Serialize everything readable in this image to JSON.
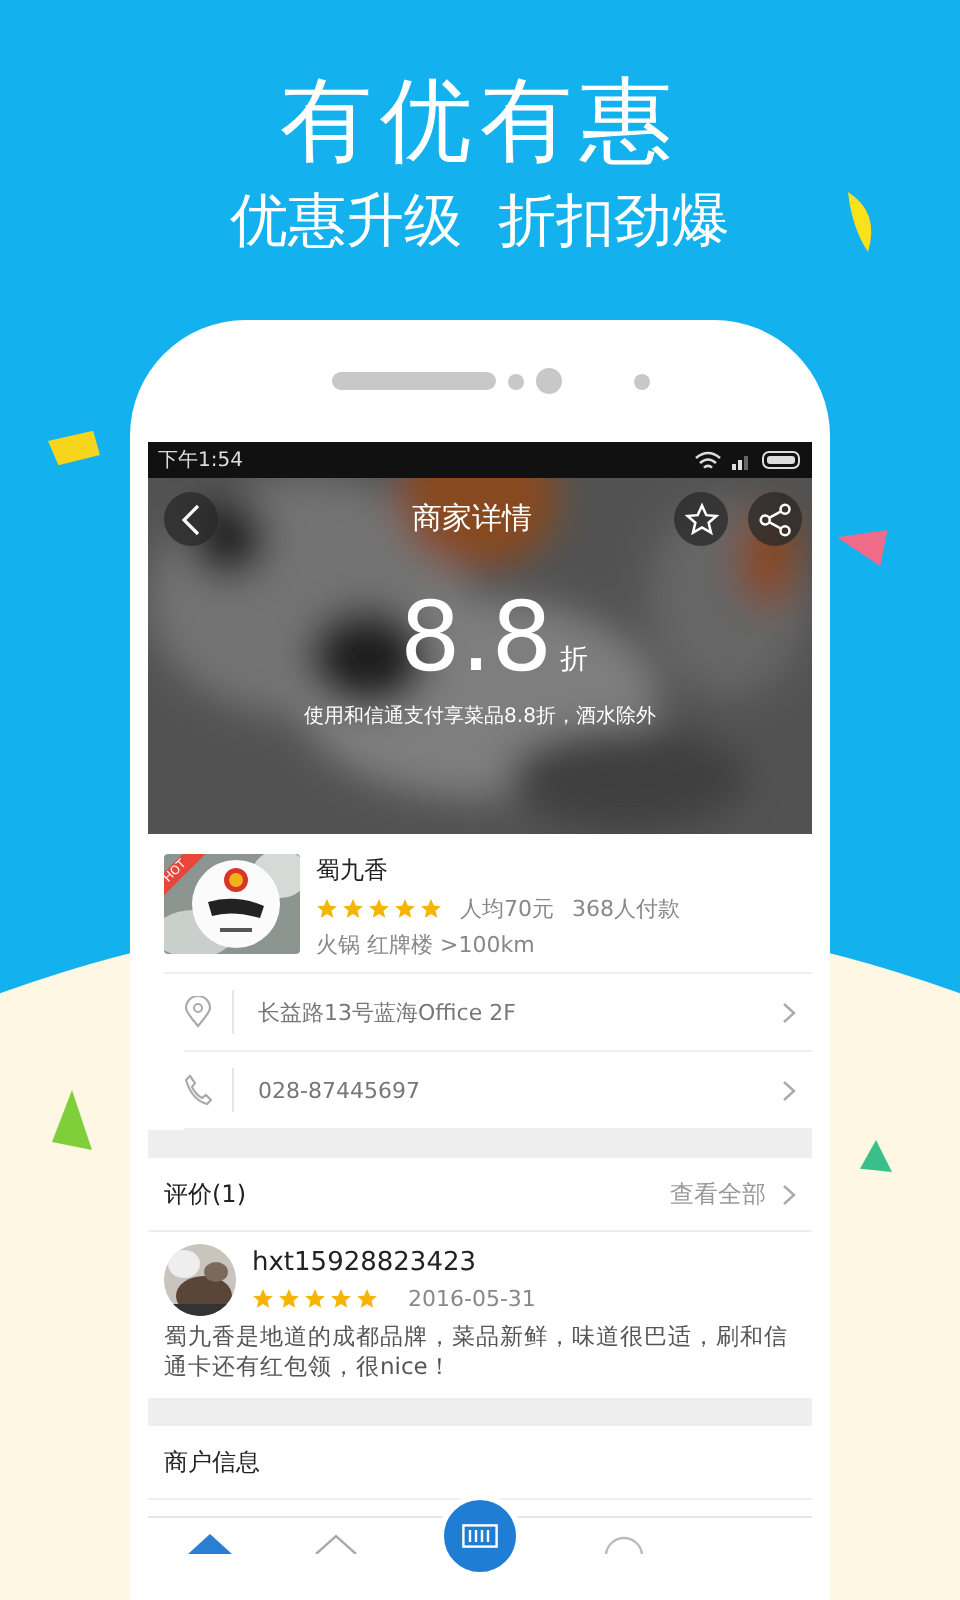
{
  "promo": {
    "headline": "有优有惠",
    "tagline": "优惠升级  折扣劲爆"
  },
  "status_bar": {
    "time": "下午1:54"
  },
  "header": {
    "title": "商家详情",
    "discount": "8.8",
    "discount_unit": "折",
    "note": "使用和信通支付享菜品8.8折，酒水除外"
  },
  "merchant": {
    "badge": "HOT",
    "name": "蜀九香",
    "stars": 5,
    "avg_price": "人均70元",
    "payments": "368人付款",
    "tags": "火锅 红牌楼 >100km"
  },
  "info_rows": [
    {
      "kind": "address",
      "text": "长益路13号蓝海Office 2F"
    },
    {
      "kind": "phone",
      "text": "028-87445697"
    }
  ],
  "reviews": {
    "title": "评价(1)",
    "link": "查看全部",
    "items": [
      {
        "user": "hxt15928823423",
        "stars": 5,
        "date": "2016-05-31",
        "text": "蜀九香是地道的成都品牌，菜品新鲜，味道很巴适，刷和信通卡还有红包领，很nice！"
      }
    ]
  },
  "merchant_info": {
    "title": "商户信息"
  }
}
